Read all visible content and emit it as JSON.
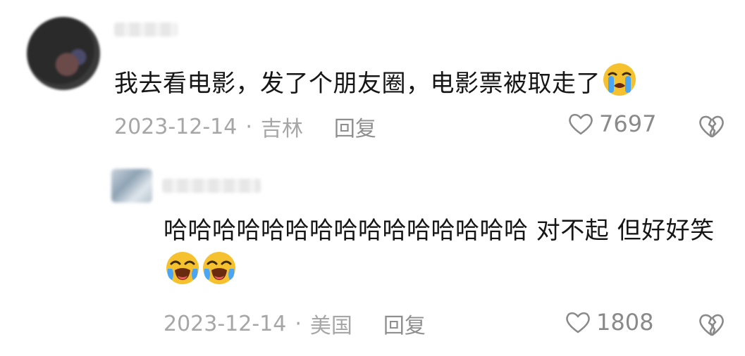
{
  "comment": {
    "text": "我去看电影，发了个朋友圈，电影票被取走了",
    "emoji": "crying-emoji",
    "date": "2023-12-14",
    "separator": "·",
    "location": "吉林",
    "reply_label": "回复",
    "likes": "7697"
  },
  "reply": {
    "text": "哈哈哈哈哈哈哈哈哈哈哈哈哈哈哈 对不起 但好好笑",
    "emojis": [
      "laugh-cry-emoji",
      "laugh-cry-emoji"
    ],
    "date": "2023-12-14",
    "separator": "·",
    "location": "美国",
    "reply_label": "回复",
    "likes": "1808"
  },
  "colors": {
    "meta_text": "#a6a6a6",
    "body_text": "#161616",
    "emoji_yellow": "#f6c12f",
    "emoji_tear": "#4aa6f5"
  }
}
